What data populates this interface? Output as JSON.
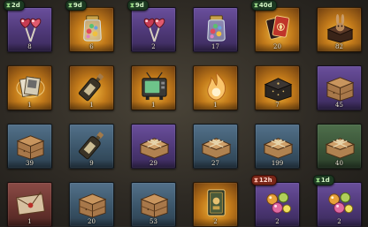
{
  "grid": {
    "rows": [
      [
        {
          "name": "heart-lollipops",
          "tier": "purple",
          "icon": "heart-lollipops-icon",
          "quantity": "8",
          "timer": "2d",
          "timer_style": "green"
        },
        {
          "name": "candy-jar",
          "tier": "gold",
          "icon": "candy-jar-icon",
          "quantity": "6",
          "timer": "9d",
          "timer_style": "green"
        },
        {
          "name": "heart-lollipops",
          "tier": "purple",
          "icon": "heart-lollipops-icon",
          "quantity": "2",
          "timer": "9d",
          "timer_style": "green"
        },
        {
          "name": "candy-jar",
          "tier": "purple",
          "icon": "candy-jar-icon",
          "quantity": "17",
          "timer": "",
          "timer_style": ""
        },
        {
          "name": "playing-cards",
          "tier": "gold",
          "icon": "playing-cards-icon",
          "quantity": "20",
          "timer": "40d",
          "timer_style": "green"
        },
        {
          "name": "rabbit-box",
          "tier": "gold",
          "icon": "rabbit-box-icon",
          "quantity": "82",
          "timer": "",
          "timer_style": ""
        }
      ],
      [
        {
          "name": "photo-album",
          "tier": "gold",
          "icon": "photo-album-icon",
          "quantity": "1",
          "timer": "",
          "timer_style": ""
        },
        {
          "name": "message-bottle",
          "tier": "gold",
          "icon": "message-bottle-icon",
          "quantity": "1",
          "timer": "",
          "timer_style": ""
        },
        {
          "name": "old-television",
          "tier": "gold",
          "icon": "old-television-icon",
          "quantity": "1",
          "timer": "",
          "timer_style": ""
        },
        {
          "name": "flame-orb",
          "tier": "gold",
          "icon": "flame-orb-icon",
          "quantity": "1",
          "timer": "",
          "timer_style": ""
        },
        {
          "name": "dark-chest",
          "tier": "gold",
          "icon": "dark-chest-icon",
          "quantity": "7",
          "timer": "",
          "timer_style": ""
        },
        {
          "name": "wooden-crate",
          "tier": "purple",
          "icon": "wooden-crate-icon",
          "quantity": "45",
          "timer": "",
          "timer_style": ""
        }
      ],
      [
        {
          "name": "wooden-crate",
          "tier": "blue",
          "icon": "wooden-crate-icon",
          "quantity": "39",
          "timer": "",
          "timer_style": ""
        },
        {
          "name": "message-bottle",
          "tier": "blue",
          "icon": "message-bottle-icon",
          "quantity": "9",
          "timer": "",
          "timer_style": ""
        },
        {
          "name": "parcel",
          "tier": "purple",
          "icon": "parcel-icon",
          "quantity": "29",
          "timer": "",
          "timer_style": ""
        },
        {
          "name": "parcel",
          "tier": "blue",
          "icon": "parcel-icon",
          "quantity": "27",
          "timer": "",
          "timer_style": ""
        },
        {
          "name": "parcel",
          "tier": "blue",
          "icon": "parcel-icon",
          "quantity": "199",
          "timer": "",
          "timer_style": ""
        },
        {
          "name": "parcel",
          "tier": "green",
          "icon": "parcel-icon",
          "quantity": "40",
          "timer": "",
          "timer_style": ""
        }
      ],
      [
        {
          "name": "envelope",
          "tier": "red",
          "icon": "envelope-icon",
          "quantity": "1",
          "timer": "",
          "timer_style": ""
        },
        {
          "name": "wooden-crate",
          "tier": "blue",
          "icon": "wooden-crate-icon",
          "quantity": "20",
          "timer": "",
          "timer_style": ""
        },
        {
          "name": "wooden-crate",
          "tier": "blue",
          "icon": "wooden-crate-icon",
          "quantity": "53",
          "timer": "",
          "timer_style": ""
        },
        {
          "name": "card-pack",
          "tier": "gold",
          "icon": "card-pack-icon",
          "quantity": "2",
          "timer": "",
          "timer_style": ""
        },
        {
          "name": "candies",
          "tier": "purple",
          "icon": "candies-icon",
          "quantity": "2",
          "timer": "12h",
          "timer_style": "red"
        },
        {
          "name": "candies",
          "tier": "purple",
          "icon": "candies-icon",
          "quantity": "2",
          "timer": "1d",
          "timer_style": "green"
        }
      ]
    ]
  },
  "colors": {
    "timer_green": "#1d3a22",
    "timer_red": "#7a2618",
    "tier_gold": "#f0b63d",
    "tier_purple": "#4e3877",
    "tier_blue": "#3b5569",
    "tier_green": "#3a5538",
    "tier_red": "#6b3530"
  }
}
